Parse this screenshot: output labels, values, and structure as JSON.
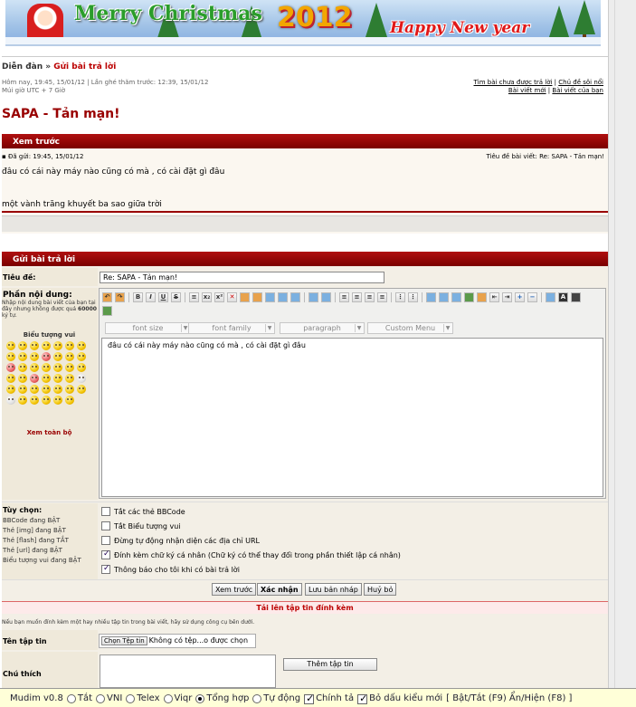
{
  "banner": {
    "merry": "Merry Christmas",
    "year": "2012",
    "newyear": "Happy New year"
  },
  "breadcrumb": {
    "root": "Diễn đàn",
    "sep": "»",
    "current": "Gửi bài trả lời"
  },
  "header": {
    "lastvisit1": "Hôm nay, 19:45, 15/01/12 | Lần ghé thăm trước: 12:39, 15/01/12",
    "lastvisit2": "Múi giờ UTC + 7 Giờ",
    "links_row1": [
      "Tìm bài chưa được trả lời",
      "Chủ đề sôi nổi"
    ],
    "links_row2": [
      "Bài viết mới",
      "Bài viết của bạn"
    ]
  },
  "page_title": "SAPA - Tản mạn!",
  "preview": {
    "heading": "Xem trước",
    "posted": "Đã gửi: 19:45, 15/01/12",
    "topic_title": "Tiêu đề bài viết: Re: SAPA - Tản mạn!",
    "line1": "đâu có cái này máy nào cũng có mà , có cài đặt gì đâu",
    "line2": "một vành trăng khuyết ba sao giữa trời"
  },
  "reply": {
    "heading": "Gửi bài trả lời",
    "subject_label": "Tiêu đề:",
    "subject_value": "Re: SAPA - Tản mạn!",
    "body_label": "Phần nội dung:",
    "body_hint": "Nhập nội dung bài viết của bạn tại đây nhưng không được quá",
    "body_limit": "60000",
    "body_unit": "ký tự.",
    "smilies_title": "Biểu tượng vui",
    "smilies_all": "Xem toàn bộ",
    "editor_selects": [
      "font size",
      "font family",
      "paragraph",
      "Custom Menu"
    ],
    "editor_text": "đâu có cái này máy nào cũng có mà , có cài đặt gì đâu"
  },
  "options": {
    "label": "Tùy chọn:",
    "status": [
      "BBCode đang BẬT",
      "Thẻ [img] đang BẬT",
      "Thẻ [flash] đang TẮT",
      "Thẻ [url] đang BẬT",
      "Biểu tượng vui đang BẬT"
    ],
    "items": [
      {
        "label": "Tắt các thẻ BBCode",
        "checked": false
      },
      {
        "label": "Tắt Biểu tượng vui",
        "checked": false
      },
      {
        "label": "Đừng tự động nhận diện các địa chỉ URL",
        "checked": false
      },
      {
        "label": "Đính kèm chữ ký cá nhân (Chữ ký có thể thay đổi trong phần thiết lập cá nhân)",
        "checked": true
      },
      {
        "label": "Thông báo cho tôi khi có bài trả lời",
        "checked": true
      }
    ]
  },
  "buttons": {
    "preview": "Xem trước",
    "submit": "Xác nhận",
    "draft": "Lưu bản nháp",
    "cancel": "Huỷ bỏ"
  },
  "upload": {
    "heading": "Tải lên tập tin đính kèm",
    "hint": "Nếu bạn muốn đính kèm một hay nhiều tập tin trong bài viết, hãy sử dụng công cụ bên dưới.",
    "file_label": "Tên tập tin",
    "choose": "Chọn Tệp tin",
    "none": "Không có tệp...o được chọn",
    "comment_label": "Chú thích",
    "add": "Thêm tập tin"
  },
  "mudim": {
    "name": "Mudim v0.8",
    "modes": [
      "Tắt",
      "VNI",
      "Telex",
      "Viqr",
      "Tổng hợp",
      "Tự động"
    ],
    "selected_mode": "Tổng hợp",
    "spell": "Chính tả",
    "remove": "Bỏ dấu kiểu mới",
    "toggle": "[ Bật/Tắt (F9) Ẩn/Hiện (F8) ]"
  }
}
